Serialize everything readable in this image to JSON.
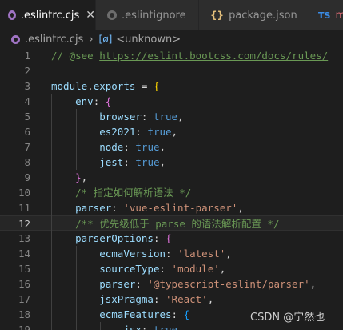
{
  "tabs": [
    {
      "label": ".eslintrc.cjs",
      "icon": "gear-icon",
      "active": true
    },
    {
      "label": ".eslintignore",
      "icon": "gear-icon"
    },
    {
      "label": "package.json",
      "icon": "json-braces-icon",
      "icon_text": "{}"
    },
    {
      "label": "ma",
      "icon": "typescript-icon",
      "icon_text": "TS"
    }
  ],
  "close_glyph": "✕",
  "breadcrumb": {
    "file": ".eslintrc.cjs",
    "separator": "›",
    "symbol_icon": "[ø]",
    "symbol": "<unknown>"
  },
  "code_lines": [
    {
      "n": "1",
      "tokens": [
        [
          "c-com",
          "// @see "
        ],
        [
          "c-link",
          "https://eslint.bootcss.com/docs/rules/"
        ]
      ]
    },
    {
      "n": "2",
      "tokens": []
    },
    {
      "n": "3",
      "tokens": [
        [
          "c-var",
          "module"
        ],
        [
          "c-p",
          "."
        ],
        [
          "c-var",
          "exports"
        ],
        [
          "c-p",
          " = "
        ],
        [
          "c-b1",
          "{"
        ]
      ]
    },
    {
      "n": "4",
      "tokens": [
        [
          "c-p",
          "    "
        ],
        [
          "c-var",
          "env"
        ],
        [
          "c-p",
          ": "
        ],
        [
          "c-b2",
          "{"
        ]
      ]
    },
    {
      "n": "5",
      "tokens": [
        [
          "c-p",
          "        "
        ],
        [
          "c-var",
          "browser"
        ],
        [
          "c-p",
          ": "
        ],
        [
          "c-kw",
          "true"
        ],
        [
          "c-p",
          ","
        ]
      ]
    },
    {
      "n": "6",
      "tokens": [
        [
          "c-p",
          "        "
        ],
        [
          "c-var",
          "es2021"
        ],
        [
          "c-p",
          ": "
        ],
        [
          "c-kw",
          "true"
        ],
        [
          "c-p",
          ","
        ]
      ]
    },
    {
      "n": "7",
      "tokens": [
        [
          "c-p",
          "        "
        ],
        [
          "c-var",
          "node"
        ],
        [
          "c-p",
          ": "
        ],
        [
          "c-kw",
          "true"
        ],
        [
          "c-p",
          ","
        ]
      ]
    },
    {
      "n": "8",
      "tokens": [
        [
          "c-p",
          "        "
        ],
        [
          "c-var",
          "jest"
        ],
        [
          "c-p",
          ": "
        ],
        [
          "c-kw",
          "true"
        ],
        [
          "c-p",
          ","
        ]
      ]
    },
    {
      "n": "9",
      "tokens": [
        [
          "c-p",
          "    "
        ],
        [
          "c-b2",
          "}"
        ],
        [
          "c-p",
          ","
        ]
      ]
    },
    {
      "n": "10",
      "tokens": [
        [
          "c-p",
          "    "
        ],
        [
          "c-com",
          "/* 指定如何解析语法 */"
        ]
      ]
    },
    {
      "n": "11",
      "tokens": [
        [
          "c-p",
          "    "
        ],
        [
          "c-var",
          "parser"
        ],
        [
          "c-p",
          ": "
        ],
        [
          "c-str",
          "'vue-eslint-parser'"
        ],
        [
          "c-p",
          ","
        ]
      ]
    },
    {
      "n": "12",
      "tokens": [
        [
          "c-p",
          "    "
        ],
        [
          "c-com",
          "/** 优先级低于 parse 的语法解析配置 */"
        ]
      ],
      "current": true
    },
    {
      "n": "13",
      "tokens": [
        [
          "c-p",
          "    "
        ],
        [
          "c-var",
          "parserOptions"
        ],
        [
          "c-p",
          ": "
        ],
        [
          "c-b2",
          "{"
        ]
      ]
    },
    {
      "n": "14",
      "tokens": [
        [
          "c-p",
          "        "
        ],
        [
          "c-var",
          "ecmaVersion"
        ],
        [
          "c-p",
          ": "
        ],
        [
          "c-str",
          "'latest'"
        ],
        [
          "c-p",
          ","
        ]
      ]
    },
    {
      "n": "15",
      "tokens": [
        [
          "c-p",
          "        "
        ],
        [
          "c-var",
          "sourceType"
        ],
        [
          "c-p",
          ": "
        ],
        [
          "c-str",
          "'module'"
        ],
        [
          "c-p",
          ","
        ]
      ]
    },
    {
      "n": "16",
      "tokens": [
        [
          "c-p",
          "        "
        ],
        [
          "c-var",
          "parser"
        ],
        [
          "c-p",
          ": "
        ],
        [
          "c-str",
          "'@typescript-eslint/parser'"
        ],
        [
          "c-p",
          ","
        ]
      ]
    },
    {
      "n": "17",
      "tokens": [
        [
          "c-p",
          "        "
        ],
        [
          "c-var",
          "jsxPragma"
        ],
        [
          "c-p",
          ": "
        ],
        [
          "c-str",
          "'React'"
        ],
        [
          "c-p",
          ","
        ]
      ]
    },
    {
      "n": "18",
      "tokens": [
        [
          "c-p",
          "        "
        ],
        [
          "c-var",
          "ecmaFeatures"
        ],
        [
          "c-p",
          ": "
        ],
        [
          "c-b3",
          "{"
        ]
      ]
    },
    {
      "n": "19",
      "tokens": [
        [
          "c-p",
          "            "
        ],
        [
          "c-var",
          "jsx"
        ],
        [
          "c-p",
          ": "
        ],
        [
          "c-kw",
          "true"
        ],
        [
          "c-p",
          ","
        ]
      ]
    }
  ],
  "watermark": "CSDN @宁然也"
}
